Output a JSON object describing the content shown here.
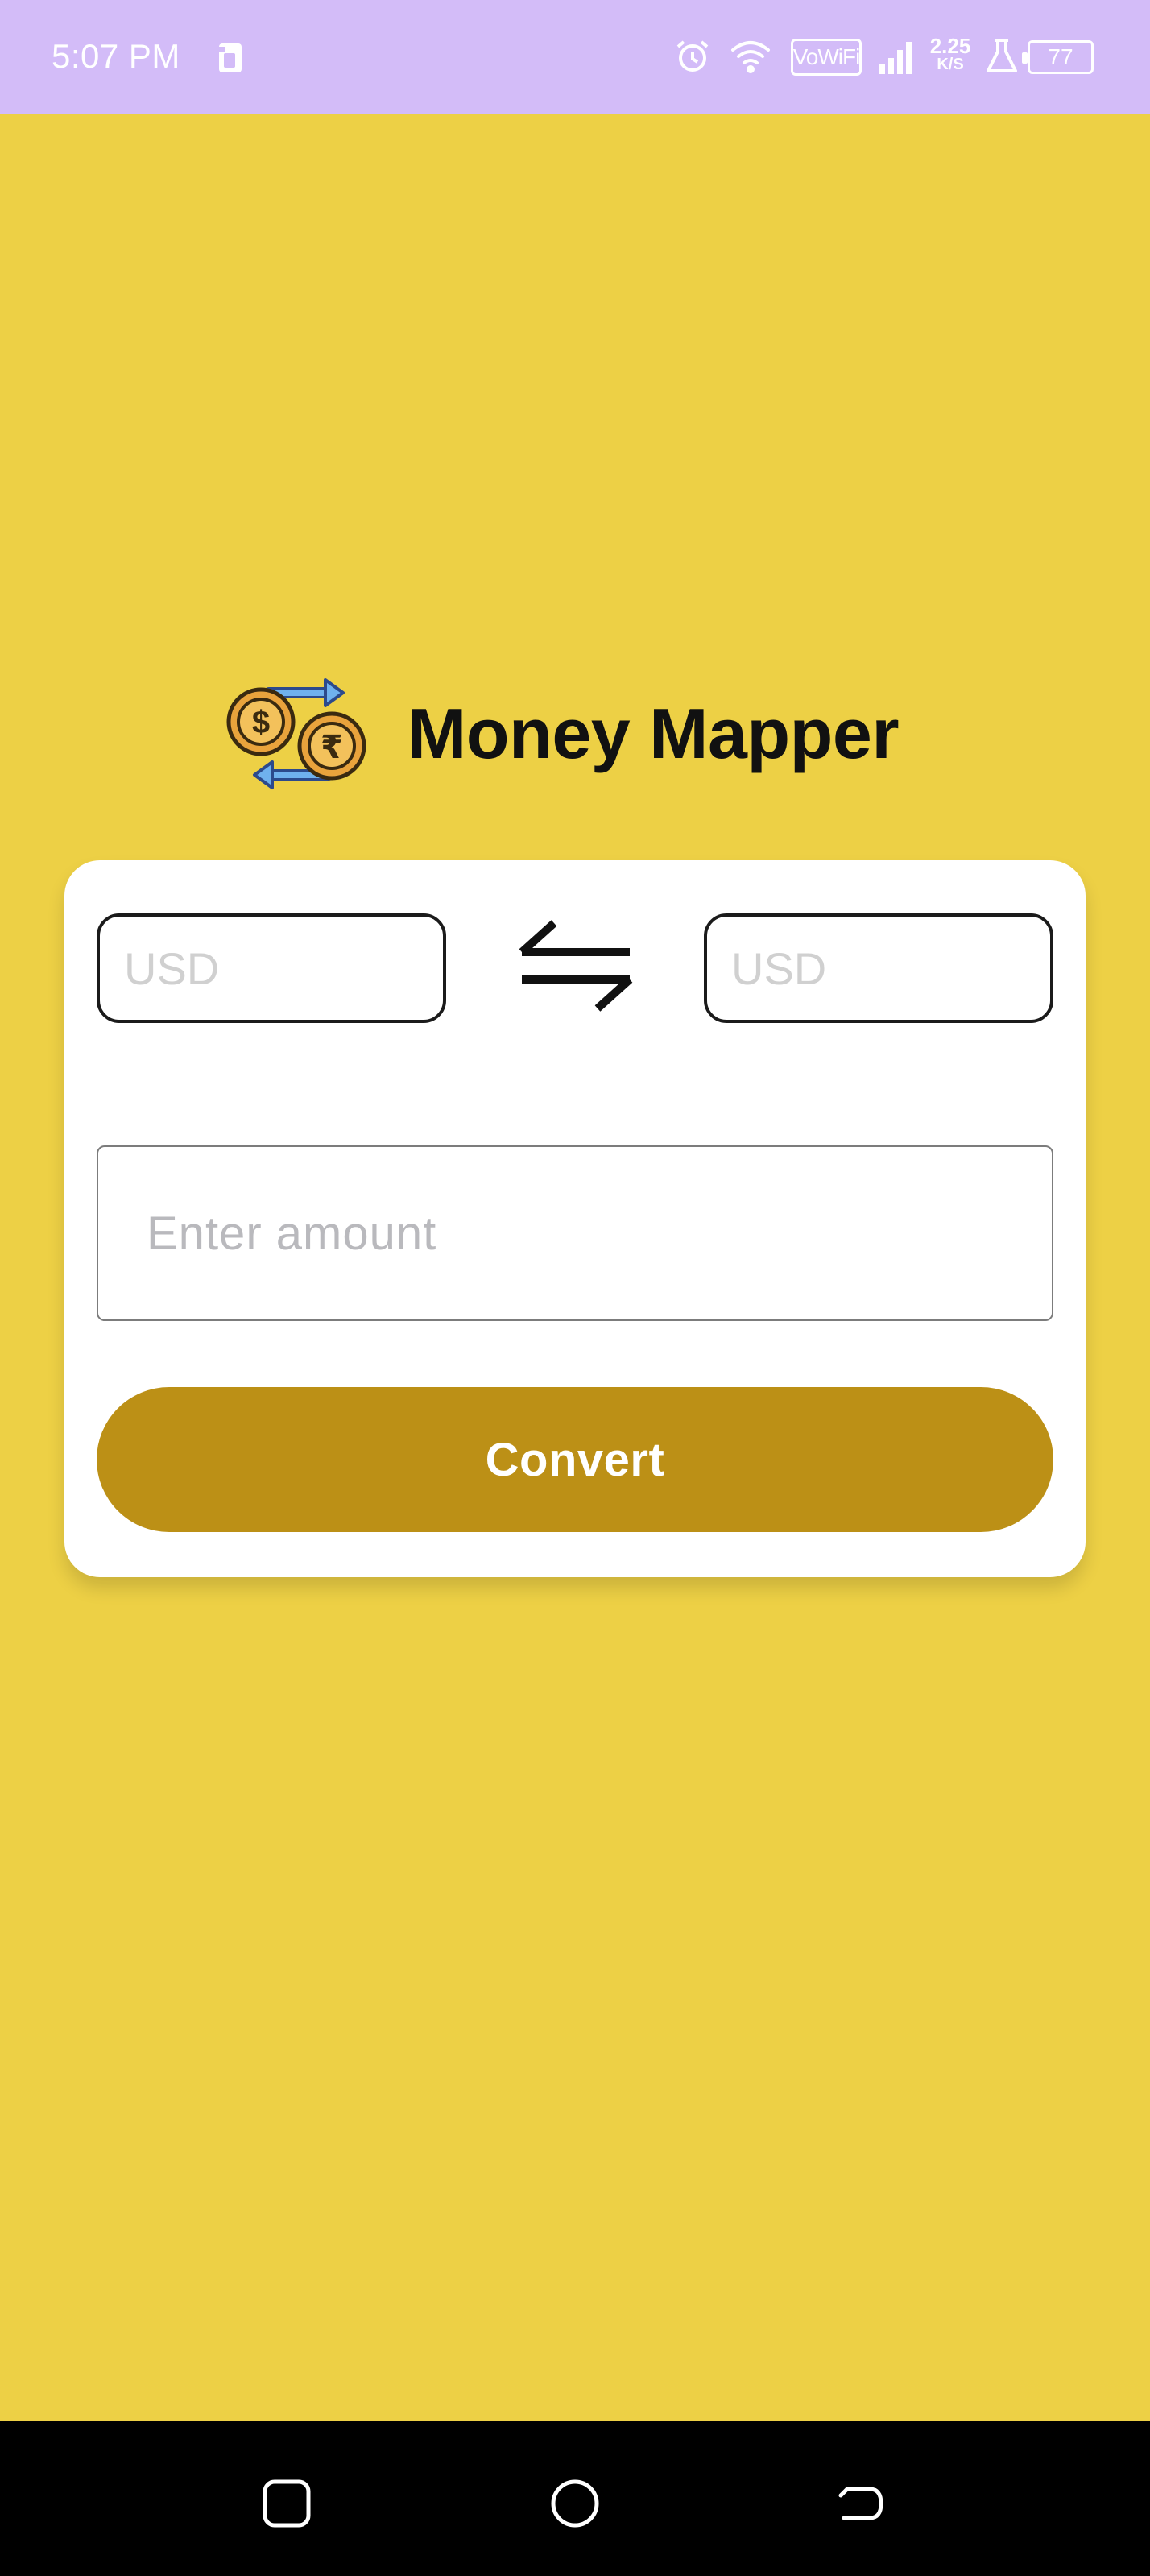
{
  "status_bar": {
    "time": "5:07 PM",
    "network_label": "VoWiFi",
    "speed_value": "2.25",
    "speed_unit": "K/S",
    "battery_level": "77",
    "icons": [
      "sim-card-icon",
      "alarm-icon",
      "wifi-icon",
      "vowifi-icon",
      "signal-icon",
      "data-speed-icon",
      "lab-flask-icon",
      "battery-icon"
    ]
  },
  "app": {
    "title": "Money Mapper",
    "logo_icon": "currency-exchange-icon"
  },
  "converter": {
    "from_currency": "USD",
    "to_currency": "USD",
    "swap_icon": "swap-arrows-icon",
    "amount_placeholder": "Enter amount",
    "amount_value": "",
    "convert_label": "Convert"
  },
  "colors": {
    "background": "#EDD045",
    "status_bar": "#D3BCF8",
    "accent_button": "#BC9016",
    "card": "#FFFFFF",
    "nav_bar": "#000000"
  },
  "nav_bar": {
    "icons": [
      "recent-apps-icon",
      "home-icon",
      "back-icon"
    ]
  }
}
